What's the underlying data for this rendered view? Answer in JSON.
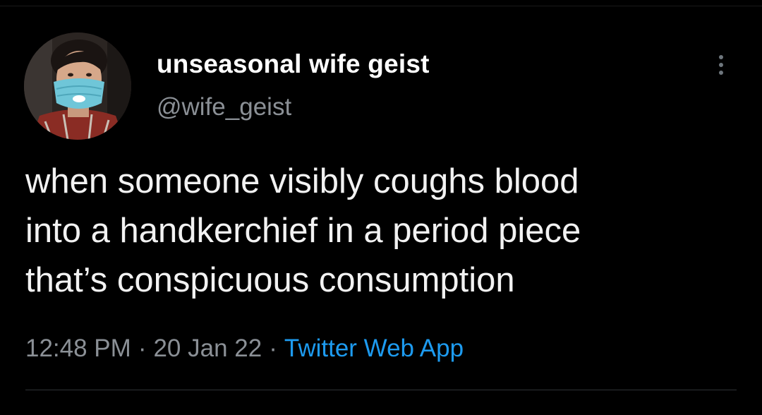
{
  "author": {
    "display_name": "unseasonal wife geist",
    "handle": "@wife_geist",
    "avatar_icon": "profile-photo-icon"
  },
  "more_icon": "more-vertical-icon",
  "tweet": {
    "lines": [
      "when someone visibly coughs blood",
      "into a handkerchief in a period piece",
      "that’s conspicuous consumption"
    ],
    "time": "12:48 PM",
    "separator": "·",
    "date": "20 Jan 22",
    "source": "Twitter Web App"
  },
  "colors": {
    "background": "#000000",
    "name": "#ffffff",
    "secondary_text": "#8b9096",
    "body_text": "#f2f2f2",
    "link": "#1d9bf0",
    "mask": "#6fc6d8"
  }
}
